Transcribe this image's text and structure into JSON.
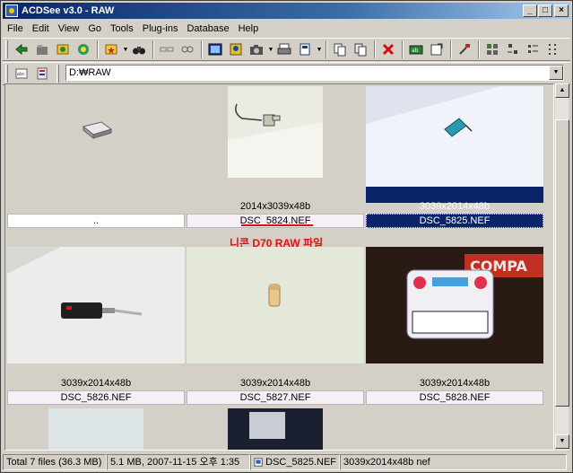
{
  "window": {
    "title": "ACDSee v3.0 - RAW"
  },
  "menu": [
    "File",
    "Edit",
    "View",
    "Go",
    "Tools",
    "Plug-ins",
    "Database",
    "Help"
  ],
  "address": {
    "value": "D:₩RAW"
  },
  "thumbnails": [
    {
      "dims": "",
      "name": ".."
    },
    {
      "dims": "2014x3039x48b",
      "name": "DSC_5824.NEF"
    },
    {
      "dims": "3039x2014x48b",
      "name": "DSC_5825.NEF"
    },
    {
      "dims": "3039x2014x48b",
      "name": "DSC_5826.NEF"
    },
    {
      "dims": "3039x2014x48b",
      "name": "DSC_5827.NEF"
    },
    {
      "dims": "3039x2014x48b",
      "name": "DSC_5828.NEF"
    }
  ],
  "annotation": "니콘 D70 RAW 파일",
  "status": {
    "total": "Total 7 files (36.3 MB)",
    "info": "5.1 MB, 2007-11-15 오후 1:35",
    "file": "DSC_5825.NEF",
    "dims": "3039x2014x48b nef"
  },
  "colors": {
    "selection": "#0a246a",
    "annotation": "#e01010",
    "titlebar": "#0a246a"
  }
}
